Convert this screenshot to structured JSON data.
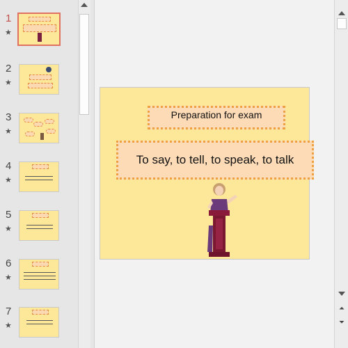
{
  "thumbnails": [
    {
      "number": "1",
      "active": true
    },
    {
      "number": "2",
      "active": false
    },
    {
      "number": "3",
      "active": false
    },
    {
      "number": "4",
      "active": false
    },
    {
      "number": "5",
      "active": false
    },
    {
      "number": "6",
      "active": false
    },
    {
      "number": "7",
      "active": false
    }
  ],
  "slide": {
    "title": "Preparation for exam",
    "subtitle": "To say, to tell, to speak, to talk"
  },
  "icons": {
    "transition_star": "star-icon",
    "scroll_up": "arrow-up-icon",
    "scroll_down": "arrow-down-icon",
    "prev_slide": "double-chevron-up-icon",
    "next_slide": "double-chevron-down-icon",
    "speaker": "speaker-at-podium-image"
  },
  "colors": {
    "slide_bg": "#fde89a",
    "box_fill": "#fddbb6",
    "box_border": "#f0a040",
    "active_thumb": "#e07060"
  }
}
